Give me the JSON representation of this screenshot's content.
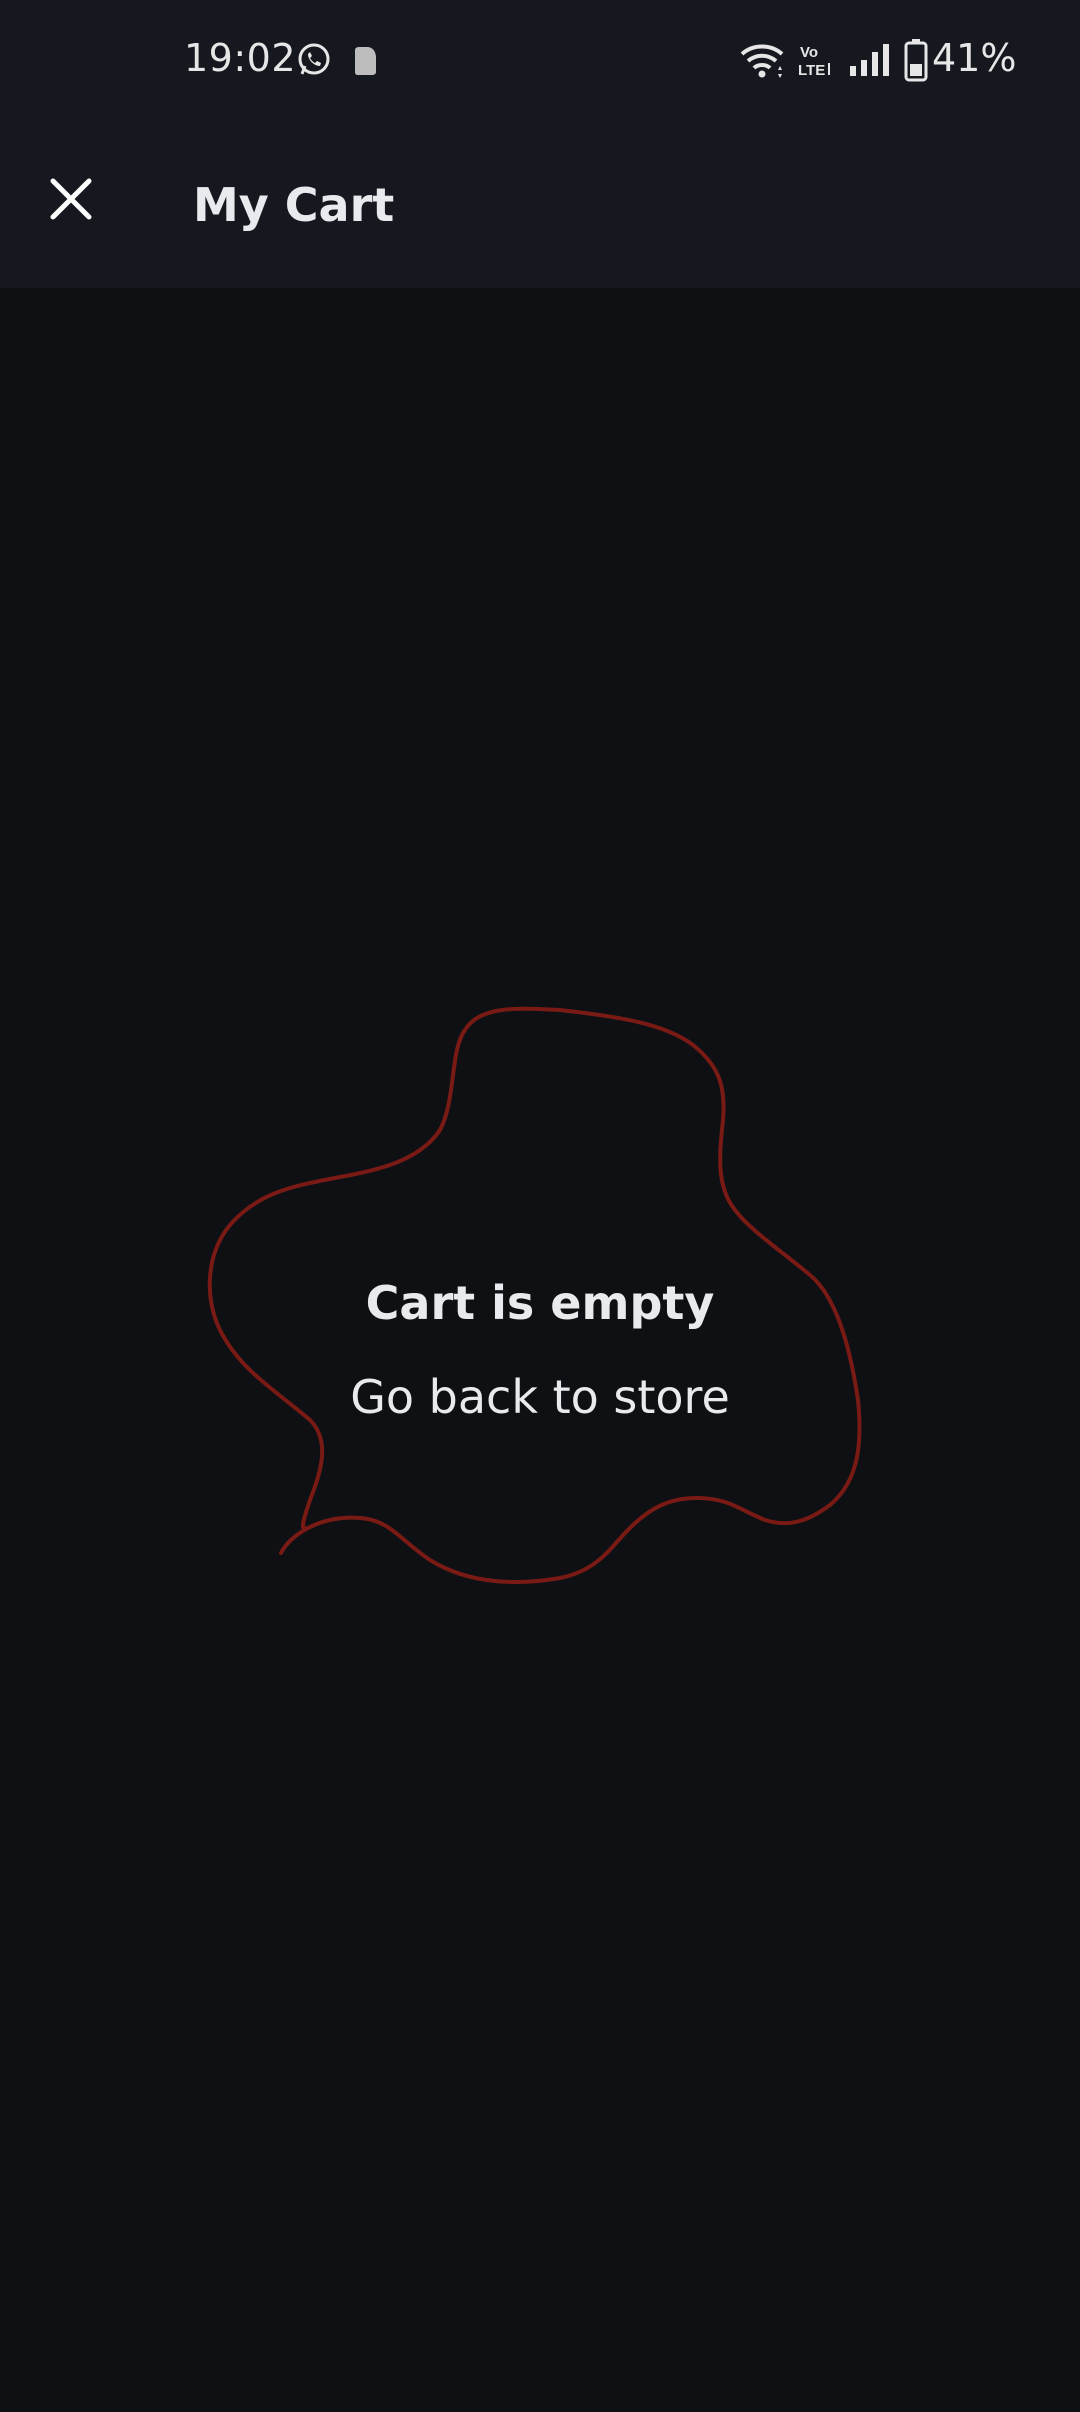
{
  "status_bar": {
    "time": "19:02",
    "battery": "41%",
    "icons": [
      "whatsapp-icon",
      "app-icon",
      "wifi-icon",
      "volte-icon",
      "signal-icon",
      "battery-icon"
    ]
  },
  "app_bar": {
    "title": "My Cart",
    "close_icon": "close-icon"
  },
  "empty_state": {
    "title": "Cart is empty",
    "link": "Go back to store"
  },
  "colors": {
    "background": "#0e1014",
    "bar_background": "#15191f",
    "text": "#e8eaed",
    "annotation": "#7a1a14"
  }
}
